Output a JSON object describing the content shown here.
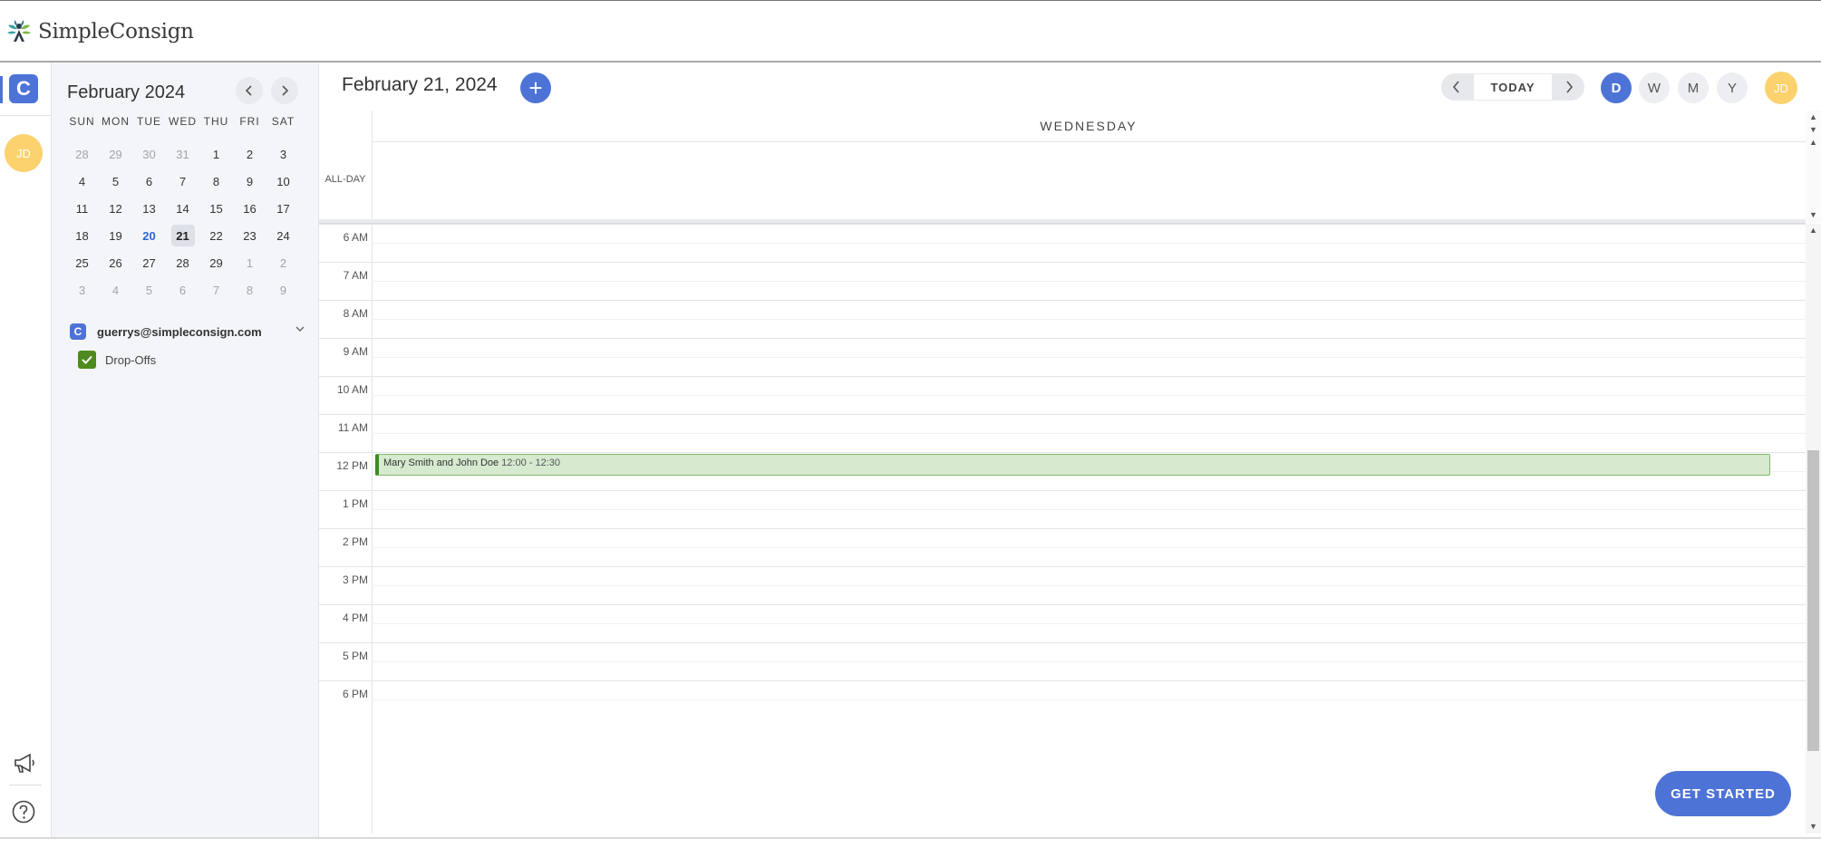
{
  "brand": {
    "name": "SimpleConsign"
  },
  "rail": {
    "app_letter": "C",
    "avatar_initials": "JD"
  },
  "mini_calendar": {
    "title": "February 2024",
    "weekdays": [
      "SUN",
      "MON",
      "TUE",
      "WED",
      "THU",
      "FRI",
      "SAT"
    ],
    "days": [
      {
        "d": "28",
        "cls": "other"
      },
      {
        "d": "29",
        "cls": "other"
      },
      {
        "d": "30",
        "cls": "other"
      },
      {
        "d": "31",
        "cls": "other"
      },
      {
        "d": "1",
        "cls": ""
      },
      {
        "d": "2",
        "cls": ""
      },
      {
        "d": "3",
        "cls": ""
      },
      {
        "d": "4",
        "cls": ""
      },
      {
        "d": "5",
        "cls": ""
      },
      {
        "d": "6",
        "cls": ""
      },
      {
        "d": "7",
        "cls": ""
      },
      {
        "d": "8",
        "cls": ""
      },
      {
        "d": "9",
        "cls": ""
      },
      {
        "d": "10",
        "cls": ""
      },
      {
        "d": "11",
        "cls": ""
      },
      {
        "d": "12",
        "cls": ""
      },
      {
        "d": "13",
        "cls": ""
      },
      {
        "d": "14",
        "cls": ""
      },
      {
        "d": "15",
        "cls": ""
      },
      {
        "d": "16",
        "cls": ""
      },
      {
        "d": "17",
        "cls": ""
      },
      {
        "d": "18",
        "cls": ""
      },
      {
        "d": "19",
        "cls": ""
      },
      {
        "d": "20",
        "cls": "today"
      },
      {
        "d": "21",
        "cls": "selected"
      },
      {
        "d": "22",
        "cls": ""
      },
      {
        "d": "23",
        "cls": ""
      },
      {
        "d": "24",
        "cls": ""
      },
      {
        "d": "25",
        "cls": ""
      },
      {
        "d": "26",
        "cls": ""
      },
      {
        "d": "27",
        "cls": ""
      },
      {
        "d": "28",
        "cls": ""
      },
      {
        "d": "29",
        "cls": ""
      },
      {
        "d": "1",
        "cls": "other"
      },
      {
        "d": "2",
        "cls": "other"
      },
      {
        "d": "3",
        "cls": "other"
      },
      {
        "d": "4",
        "cls": "other"
      },
      {
        "d": "5",
        "cls": "other"
      },
      {
        "d": "6",
        "cls": "other"
      },
      {
        "d": "7",
        "cls": "other"
      },
      {
        "d": "8",
        "cls": "other"
      },
      {
        "d": "9",
        "cls": "other"
      }
    ]
  },
  "account": {
    "icon_letter": "C",
    "email": "guerrys@simpleconsign.com"
  },
  "calendars": [
    {
      "label": "Drop-Offs",
      "checked": true,
      "color": "#4e8a1f"
    }
  ],
  "header": {
    "date_title": "February 21, 2024",
    "add_label": "+",
    "today_label": "TODAY",
    "views": {
      "d": "D",
      "w": "W",
      "m": "M",
      "y": "Y"
    },
    "active_view": "D",
    "avatar_initials": "JD"
  },
  "day_view": {
    "weekday": "WEDNESDAY",
    "allday_label": "ALL-DAY",
    "hours": [
      "6 AM",
      "7 AM",
      "8 AM",
      "9 AM",
      "10 AM",
      "11 AM",
      "12 PM",
      "1 PM",
      "2 PM",
      "3 PM",
      "4 PM",
      "5 PM",
      "6 PM"
    ],
    "events": [
      {
        "title": "Mary Smith and John Doe",
        "time": "12:00 - 12:30",
        "color": "#3e8a1e"
      }
    ]
  },
  "cta": {
    "label": "GET STARTED"
  },
  "colors": {
    "accent": "#4e73d6",
    "avatar": "#fcd26e",
    "event_bg": "#d6eacf"
  }
}
